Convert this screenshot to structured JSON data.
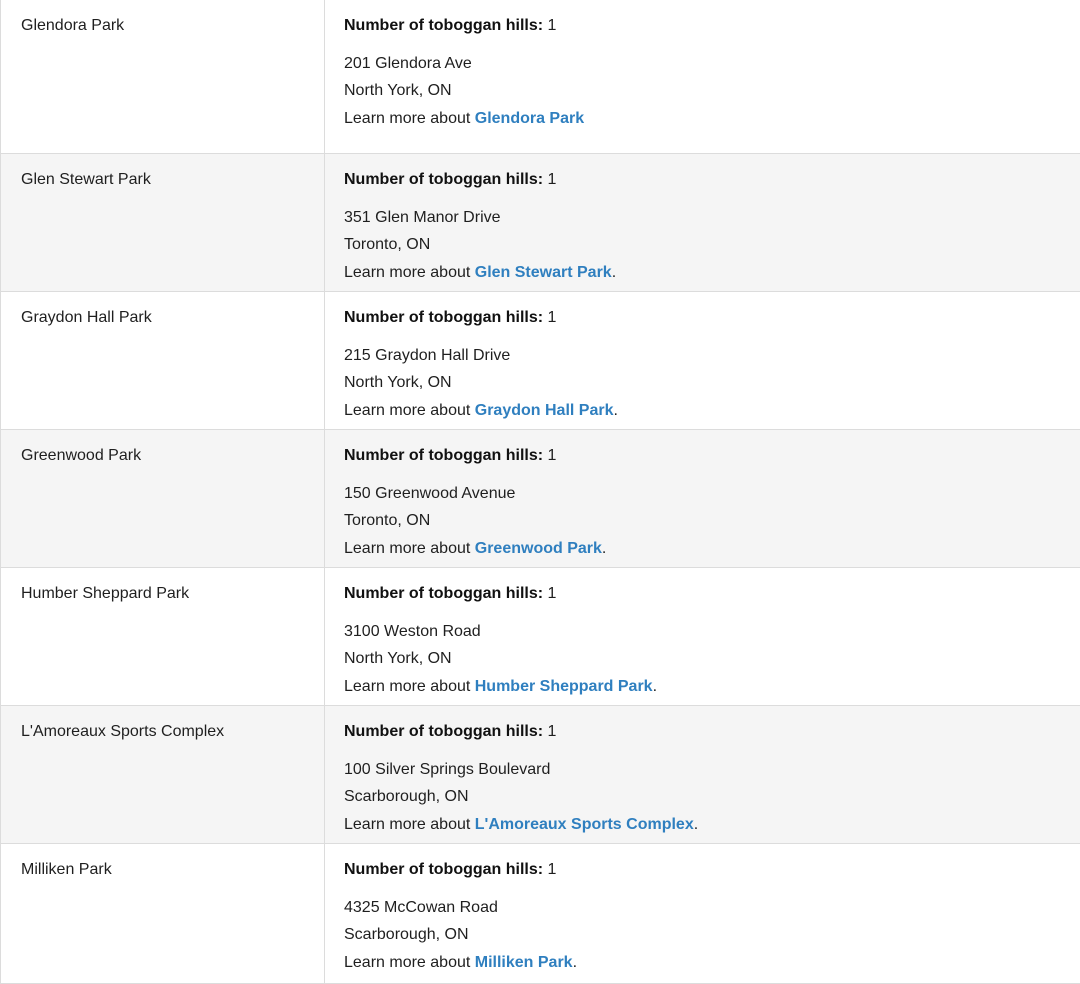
{
  "hills_label": "Number of toboggan hills:",
  "learn_prefix": "Learn more about ",
  "rows": [
    {
      "name": "Glendora Park",
      "hills": "1",
      "street": "201 Glendora Ave",
      "city": "North York, ON",
      "link": "Glendora Park",
      "suffix": ""
    },
    {
      "name": "Glen Stewart Park",
      "hills": "1",
      "street": "351 Glen Manor Drive",
      "city": "Toronto, ON",
      "link": "Glen Stewart Park",
      "suffix": "."
    },
    {
      "name": "Graydon Hall Park",
      "hills": "1",
      "street": "215 Graydon Hall Drive",
      "city": "North York, ON",
      "link": "Graydon Hall Park",
      "suffix": "."
    },
    {
      "name": "Greenwood Park",
      "hills": "1",
      "street": "150 Greenwood Avenue",
      "city": "Toronto, ON",
      "link": "Greenwood Park",
      "suffix": "."
    },
    {
      "name": "Humber Sheppard Park",
      "hills": "1",
      "street": "3100 Weston Road",
      "city": "North York, ON",
      "link": "Humber Sheppard Park",
      "suffix": "."
    },
    {
      "name": "L'Amoreaux Sports Complex",
      "hills": "1",
      "street": "100 Silver Springs Boulevard",
      "city": "Scarborough, ON",
      "link": "L'Amoreaux Sports Complex",
      "suffix": "."
    },
    {
      "name": "Milliken Park",
      "hills": "1",
      "street": "4325 McCowan Road",
      "city": "Scarborough, ON",
      "link": "Milliken Park",
      "suffix": "."
    }
  ]
}
